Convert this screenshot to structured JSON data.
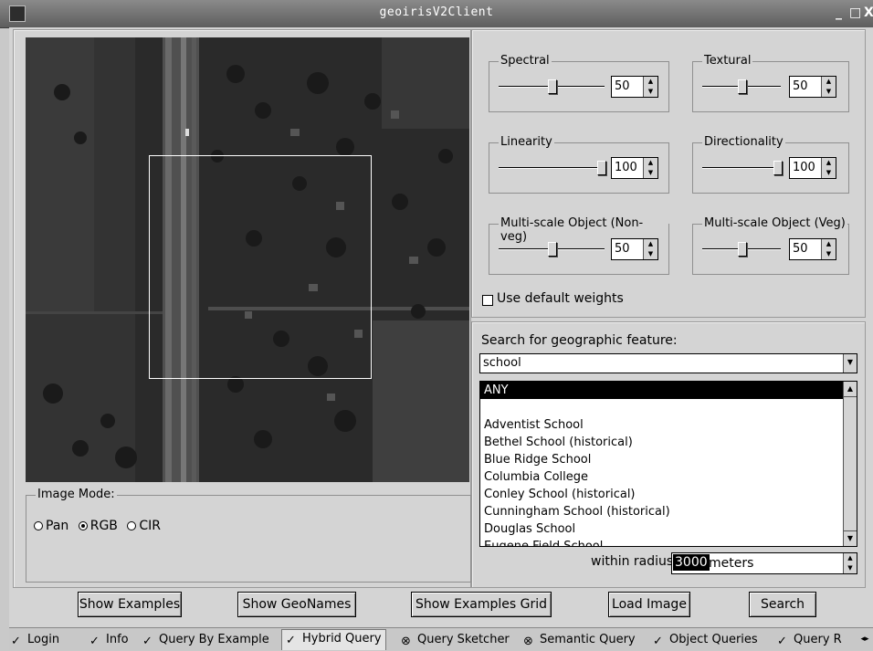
{
  "window": {
    "title": "geoirisV2Client"
  },
  "weights": {
    "spectral": {
      "label": "Spectral",
      "value": "50",
      "level": 50
    },
    "textural": {
      "label": "Textural",
      "value": "50",
      "level": 50
    },
    "linearity": {
      "label": "Linearity",
      "value": "100",
      "level": 100
    },
    "directionality": {
      "label": "Directionality",
      "value": "100",
      "level": 100
    },
    "msobj_nonveg": {
      "label": "Multi-scale Object (Non-veg)",
      "value": "50",
      "level": 50
    },
    "msobj_veg": {
      "label": "Multi-scale Object (Veg)",
      "value": "50",
      "level": 50
    },
    "use_default_label": "Use default weights",
    "use_default_checked": false
  },
  "geo_search": {
    "label": "Search for geographic feature:",
    "input_value": "school",
    "list": [
      "ANY",
      "",
      "Adventist School",
      "Bethel School (historical)",
      "Blue Ridge School",
      "Columbia College",
      "Conley School (historical)",
      "Cunningham School (historical)",
      "Douglas School",
      "Eugene Field School"
    ],
    "selected_index": 0,
    "radius_label": "within radius",
    "radius_value": "3000",
    "radius_unit": "meters"
  },
  "image_mode": {
    "label": "Image Mode:",
    "options": [
      "Pan",
      "RGB",
      "CIR"
    ],
    "selected": "RGB"
  },
  "buttons": {
    "show_examples": "Show Examples",
    "show_geonames": "Show GeoNames",
    "show_examples_grid": "Show Examples Grid",
    "load_image": "Load Image",
    "search": "Search"
  },
  "tabs": [
    "Login",
    "Info",
    "Query By Example",
    "Hybrid Query",
    "Query Sketcher",
    "Semantic Query",
    "Object Queries",
    "Query R"
  ],
  "active_tab": "Hybrid Query",
  "icons": {
    "app": "app-icon",
    "minimize": "minimize-icon",
    "maximize": "maximize-icon",
    "close": "close-icon"
  }
}
